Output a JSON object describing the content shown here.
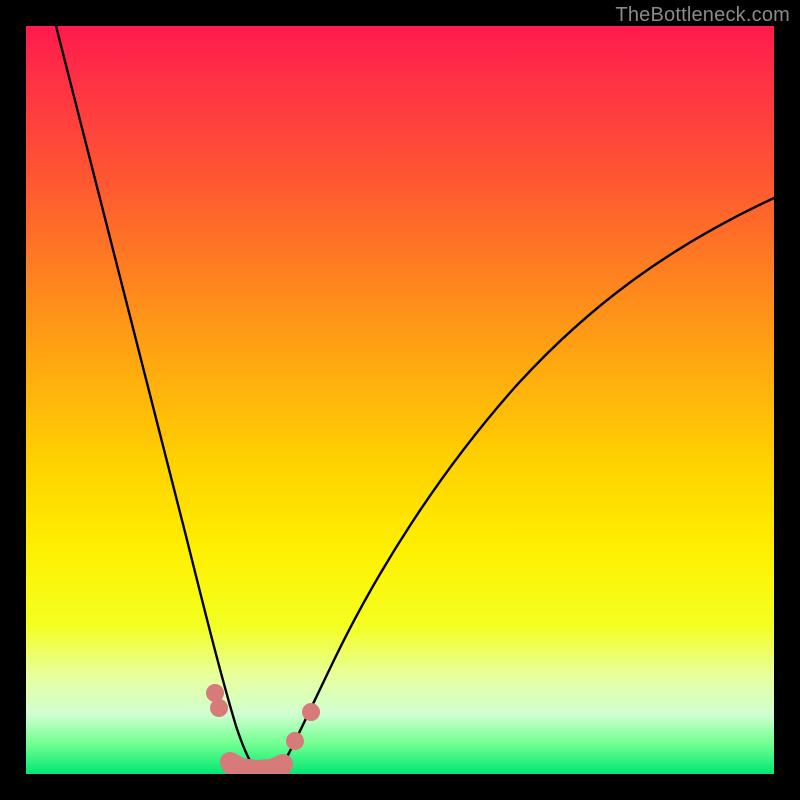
{
  "watermark": "TheBottleneck.com",
  "chart_data": {
    "type": "line",
    "title": "",
    "xlabel": "",
    "ylabel": "",
    "xlim": [
      0,
      100
    ],
    "ylim": [
      0,
      100
    ],
    "grid": false,
    "legend": false,
    "background_gradient": [
      {
        "pos": 0.0,
        "color": "#ff1a4d"
      },
      {
        "pos": 0.5,
        "color": "#ffd000"
      },
      {
        "pos": 0.85,
        "color": "#f4ff20"
      },
      {
        "pos": 1.0,
        "color": "#00e874"
      }
    ],
    "series": [
      {
        "name": "left-curve",
        "x": [
          4,
          10,
          16,
          20,
          24,
          27,
          29,
          30
        ],
        "y": [
          100,
          72,
          44,
          28,
          14,
          5,
          1,
          0
        ]
      },
      {
        "name": "right-curve",
        "x": [
          33,
          35,
          40,
          48,
          60,
          75,
          90,
          100
        ],
        "y": [
          0,
          2,
          10,
          26,
          46,
          62,
          72,
          77
        ]
      }
    ],
    "points": [
      {
        "x": 25.0,
        "y": 11
      },
      {
        "x": 25.5,
        "y": 9
      },
      {
        "x": 36.0,
        "y": 4
      },
      {
        "x": 38.5,
        "y": 8
      }
    ],
    "flat_region": {
      "x_start": 27,
      "x_end": 34,
      "y": 0.5
    },
    "accent_color": "#d77a7a"
  }
}
